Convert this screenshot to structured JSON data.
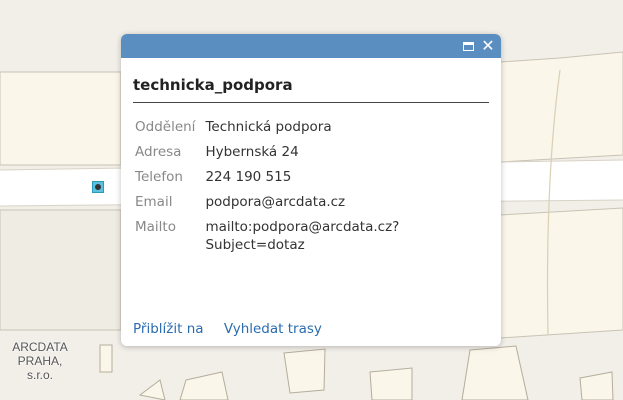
{
  "map": {
    "label": "ARCDATA\nPRAHA,\ns.r.o.",
    "colors": {
      "background": "#f2efe9",
      "road": "#ffffff",
      "building": "#faf6ea",
      "building_edge": "#c9c3b5"
    },
    "marker_icon": "point-marker-icon"
  },
  "popup": {
    "title": "technicka_podpora",
    "header_color": "#5b8ec0",
    "maximize_icon": "maximize-icon",
    "close_icon": "close-icon",
    "fields": [
      {
        "name": "Oddělení",
        "value": "Technická podpora"
      },
      {
        "name": "Adresa",
        "value": "Hybernská 24"
      },
      {
        "name": "Telefon",
        "value": "224 190 515"
      },
      {
        "name": "Email",
        "value": "podpora@arcdata.cz"
      },
      {
        "name": "Mailto",
        "value": "mailto:podpora@arcdata.cz?Subject=dotaz"
      }
    ],
    "actions": {
      "zoom_to": "Přiblížit na",
      "directions": "Vyhledat trasy"
    }
  }
}
